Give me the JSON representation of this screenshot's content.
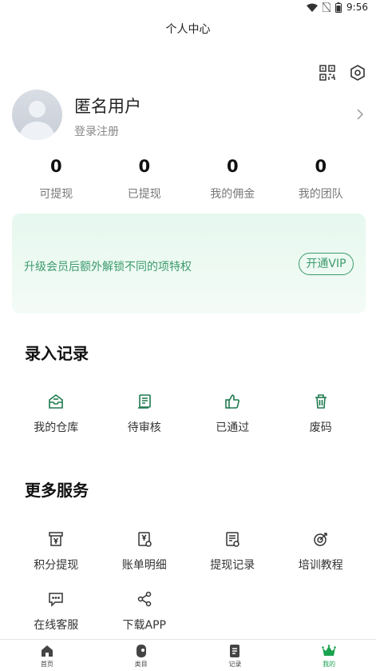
{
  "status_bar": {
    "time": "9:56"
  },
  "header": {
    "title": "个人中心"
  },
  "profile": {
    "name": "匿名用户",
    "login_link": "登录注册"
  },
  "stats": [
    {
      "value": "0",
      "label": "可提现"
    },
    {
      "value": "0",
      "label": "已提现"
    },
    {
      "value": "0",
      "label": "我的佣金"
    },
    {
      "value": "0",
      "label": "我的团队"
    }
  ],
  "vip_banner": {
    "text": "升级会员后额外解锁不同的项特权",
    "button": "开通VIP"
  },
  "records": {
    "title": "录入记录",
    "items": [
      {
        "label": "我的仓库",
        "icon": "warehouse-icon"
      },
      {
        "label": "待审核",
        "icon": "pending-review-icon"
      },
      {
        "label": "已通过",
        "icon": "thumbs-up-icon"
      },
      {
        "label": "废码",
        "icon": "trash-icon"
      }
    ]
  },
  "services": {
    "title": "更多服务",
    "items": [
      {
        "label": "积分提现",
        "icon": "points-withdraw-icon"
      },
      {
        "label": "账单明细",
        "icon": "bill-detail-icon"
      },
      {
        "label": "提现记录",
        "icon": "withdraw-record-icon"
      },
      {
        "label": "培训教程",
        "icon": "target-icon"
      },
      {
        "label": "在线客服",
        "icon": "chat-icon"
      },
      {
        "label": "下载APP",
        "icon": "share-icon"
      }
    ]
  },
  "tabbar": {
    "items": [
      {
        "label": "首页",
        "icon": "home-icon",
        "active": false
      },
      {
        "label": "类目",
        "icon": "category-icon",
        "active": false
      },
      {
        "label": "记录",
        "icon": "record-icon",
        "active": false
      },
      {
        "label": "我的",
        "icon": "crown-icon",
        "active": true
      }
    ],
    "accent": "#1aa24f"
  },
  "colors": {
    "accent_green": "#3d9a6c",
    "banner_bg": "#e9f8f0"
  }
}
